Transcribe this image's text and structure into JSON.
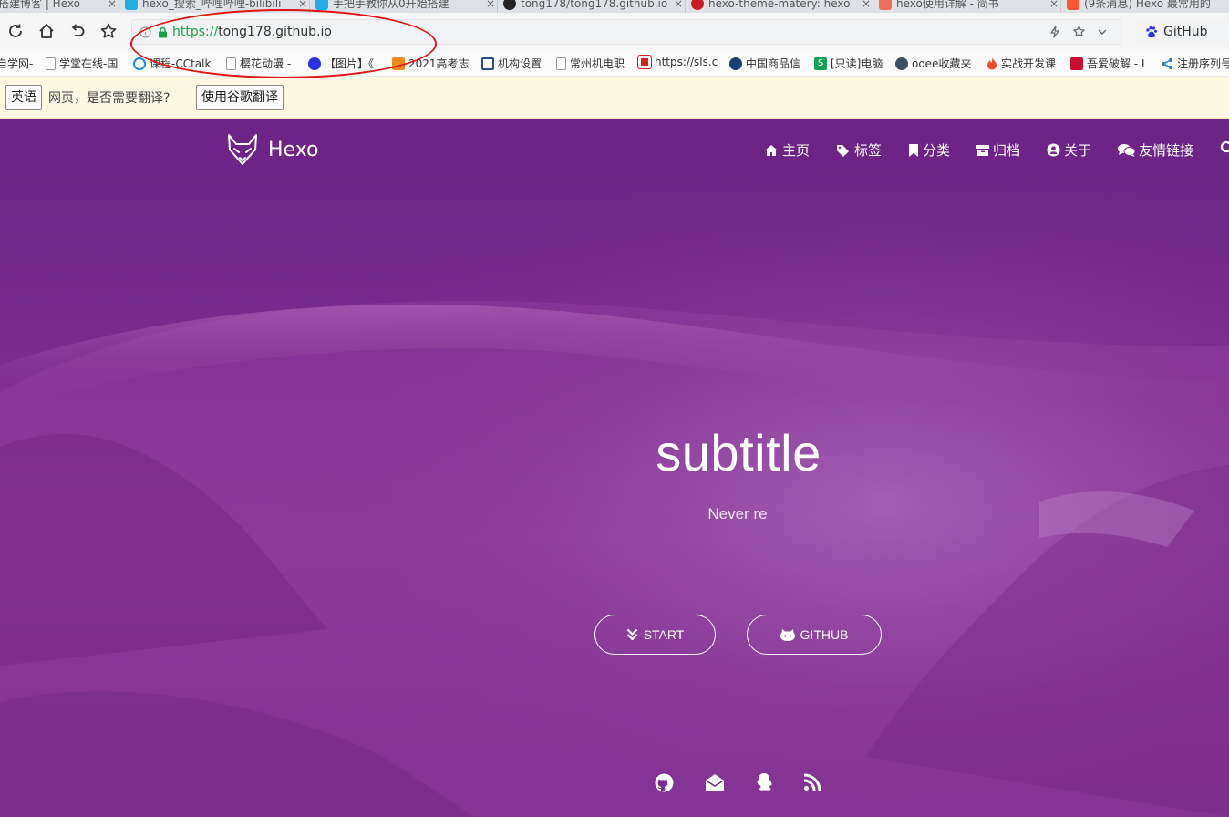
{
  "tabs": [
    {
      "title": "搭建博客 | Hexo",
      "icon_color": "#ffffff"
    },
    {
      "title": "hexo_搜索_哔哩哔哩-bilibili",
      "icon_color": "#23ade5"
    },
    {
      "title": "手把手教你从0开始搭建",
      "icon_color": "#23ade5"
    },
    {
      "title": "tong178/tong178.github.io",
      "icon_color": "#222222"
    },
    {
      "title": "hexo-theme-matery: hexo",
      "icon_color": "#c71d23"
    },
    {
      "title": "hexo使用详解 - 简书",
      "icon_color": "#ea6f5a"
    },
    {
      "title": "(9条消息) Hexo 最常用的",
      "icon_color": "#fc5531"
    }
  ],
  "tab_close": "×",
  "toolbar": {
    "url_scheme": "https://",
    "url_host": "tong178.github.io",
    "search_engine_label": "GitHub"
  },
  "bookmarks": [
    {
      "label": "自学网-",
      "icon": "none"
    },
    {
      "label": "学堂在线-国",
      "icon": "page-icon"
    },
    {
      "label": "课程-CCtalk",
      "icon": "cctalk-icon"
    },
    {
      "label": "樱花动漫 -",
      "icon": "page-icon"
    },
    {
      "label": "【图片】《",
      "icon": "baidu-icon"
    },
    {
      "label": "2021高考志",
      "icon": "gaokao-icon"
    },
    {
      "label": "机构设置",
      "icon": "org-icon"
    },
    {
      "label": "常州机电职",
      "icon": "page-icon"
    },
    {
      "label": "https://sls.c",
      "icon": "sls-icon"
    },
    {
      "label": "中国商品信",
      "icon": "globe-icon"
    },
    {
      "label": "[只读]电脑",
      "icon": "s-icon"
    },
    {
      "label": "ooee收藏夹",
      "icon": "wordpress-icon"
    },
    {
      "label": "实战开发课",
      "icon": "fire-icon"
    },
    {
      "label": "吾爱破解 - L",
      "icon": "52pojie-icon"
    },
    {
      "label": "注册序列号",
      "icon": "share-icon"
    }
  ],
  "translate_bar": {
    "language_button": "英语",
    "question": "网页，是否需要翻译?",
    "translate_button": "使用谷歌翻译"
  },
  "site": {
    "brand": "Hexo",
    "menu": [
      {
        "label": "主页",
        "icon": "home-icon"
      },
      {
        "label": "标签",
        "icon": "tags-icon"
      },
      {
        "label": "分类",
        "icon": "bookmark-icon"
      },
      {
        "label": "归档",
        "icon": "archive-icon"
      },
      {
        "label": "关于",
        "icon": "user-circle-icon"
      },
      {
        "label": "友情链接",
        "icon": "comments-icon"
      }
    ],
    "hero_title": "subtitle",
    "hero_subtitle": "Never re",
    "start_button": "START",
    "github_button": "GITHUB",
    "social": [
      "github-icon",
      "envelope-open-icon",
      "qq-icon",
      "rss-icon"
    ]
  },
  "colors": {
    "hero_purple": "#7a2b8e",
    "url_scheme_green": "#1aa34a",
    "annotation_red": "#e01515",
    "translate_bar_bg": "#fdf8e4"
  }
}
